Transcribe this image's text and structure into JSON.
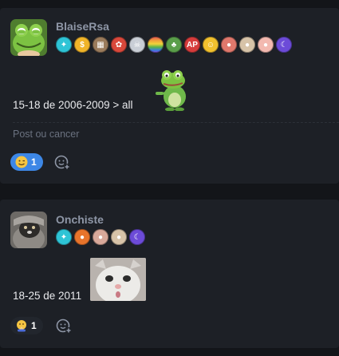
{
  "posts": [
    {
      "username": "BlaiseRsa",
      "avatar": "frog-avatar",
      "badges": [
        {
          "icon": "sparkle-badge-icon",
          "color": "#2ec4d6",
          "glyph": "✦"
        },
        {
          "icon": "dollar-badge-icon",
          "color": "#f0b429",
          "glyph": "$"
        },
        {
          "icon": "cube-badge-icon",
          "color": "#9a7b5c",
          "glyph": "▦"
        },
        {
          "icon": "flower-badge-icon",
          "color": "#d9483b",
          "glyph": "✿"
        },
        {
          "icon": "skull-badge-icon",
          "color": "#c9ced6",
          "glyph": "☠"
        },
        {
          "icon": "rainbow-badge-icon",
          "color": "#e25555",
          "glyph": ""
        },
        {
          "icon": "sprout-badge-icon",
          "color": "#5a9e4a",
          "glyph": "♣"
        },
        {
          "icon": "ap-badge-icon",
          "color": "#d63c3c",
          "glyph": "AP"
        },
        {
          "icon": "smiley-badge-icon",
          "color": "#f2c12e",
          "glyph": "☺"
        },
        {
          "icon": "pig-badge-icon",
          "color": "#e0786c",
          "glyph": "●"
        },
        {
          "icon": "cat-badge-icon",
          "color": "#d7c3a8",
          "glyph": "●"
        },
        {
          "icon": "girl-badge-icon",
          "color": "#f3b9b0",
          "glyph": "●"
        },
        {
          "icon": "moon-badge-icon",
          "color": "#6c4bd8",
          "glyph": "☾"
        }
      ],
      "text": "15-18 de 2006-2009 > all",
      "sticker": "frog-sticker",
      "comment_placeholder": "Post ou cancer",
      "reaction": {
        "icon": "wink-emoji-icon",
        "count": "1"
      }
    },
    {
      "username": "Onchiste",
      "avatar": "cat-avatar",
      "badges": [
        {
          "icon": "sparkle-badge-icon",
          "color": "#2ec4d6",
          "glyph": "✦"
        },
        {
          "icon": "fox-badge-icon",
          "color": "#e8742b",
          "glyph": "●"
        },
        {
          "icon": "baby-badge-icon",
          "color": "#d8a89a",
          "glyph": "●"
        },
        {
          "icon": "cat-badge-icon",
          "color": "#d7c3a8",
          "glyph": "●"
        },
        {
          "icon": "moon-badge-icon",
          "color": "#6c4bd8",
          "glyph": "☾"
        }
      ],
      "text": "18-25 de 2011",
      "sticker": "cat-sticker",
      "reaction": {
        "icon": "pray-emoji-icon",
        "count": "1"
      }
    }
  ]
}
